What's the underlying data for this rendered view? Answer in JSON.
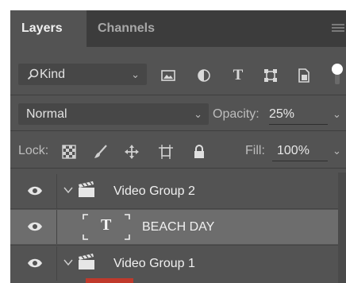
{
  "tabs": [
    {
      "label": "Layers",
      "active": true
    },
    {
      "label": "Channels",
      "active": false
    }
  ],
  "filter": {
    "kind_label": "Kind",
    "icons": [
      "image-filter-icon",
      "adjustment-filter-icon",
      "type-filter-icon",
      "shape-filter-icon",
      "smart-object-filter-icon"
    ],
    "type_glyph": "T"
  },
  "blend": {
    "mode": "Normal",
    "opacity_label": "Opacity:",
    "opacity_value": "25%"
  },
  "lock": {
    "label": "Lock:",
    "icons": [
      "lock-transparent-pixels-icon",
      "lock-image-pixels-icon",
      "lock-position-icon",
      "lock-artboard-icon",
      "lock-all-icon"
    ],
    "fill_label": "Fill:",
    "fill_value": "100%"
  },
  "layers": [
    {
      "name": "Video Group 2",
      "kind": "video-group",
      "visible": true,
      "expanded": true,
      "selected": false
    },
    {
      "name": "BEACH DAY",
      "kind": "type",
      "visible": true,
      "selected": true,
      "thumb_glyph": "T"
    },
    {
      "name": "Video Group 1",
      "kind": "video-group",
      "visible": true,
      "expanded": true,
      "selected": false
    }
  ],
  "colors": {
    "panel": "#535353",
    "tabbar": "#3c3c3c",
    "selected_row": "#6d6d6d",
    "text": "#f0f0f0"
  }
}
